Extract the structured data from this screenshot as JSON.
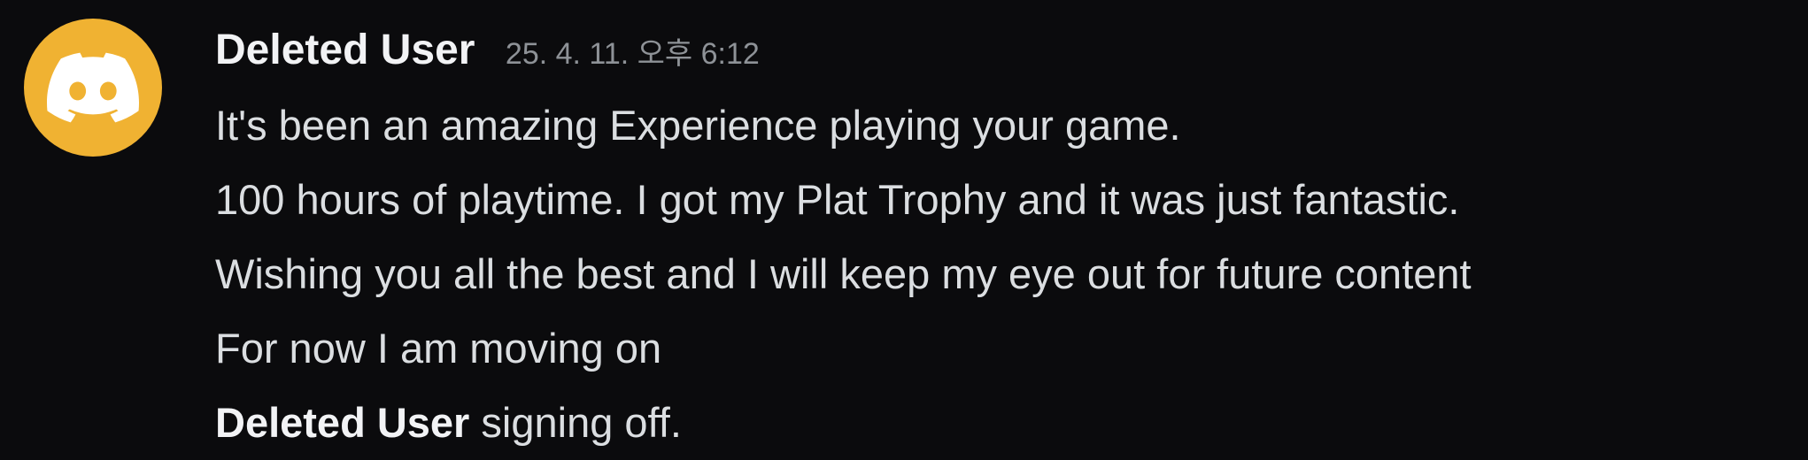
{
  "message": {
    "author": "Deleted User",
    "timestamp": "25. 4. 11. 오후 6:12",
    "avatar_icon": "discord-logo-icon",
    "avatar_color": "#f0b232",
    "lines": [
      "It's been an amazing Experience playing your game.",
      "100 hours of playtime. I got my Plat Trophy and it was just fantastic.",
      "Wishing you all the best and I will keep my eye out for future content",
      "For now I am moving on"
    ],
    "closing": {
      "bold": "Deleted User",
      "rest": " signing off."
    }
  }
}
